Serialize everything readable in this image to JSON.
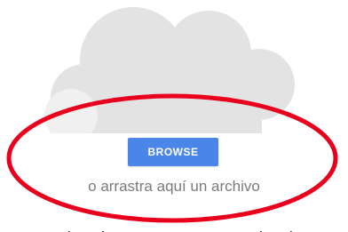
{
  "upload": {
    "button_label": "BROWSE",
    "drop_hint": "o arrastra aquí un archivo"
  },
  "colors": {
    "button": "#4a86e8",
    "cloud": "#e3e3e3",
    "cloud_dark": "#dcdcdc",
    "highlight": "#e8001c",
    "hint_text": "#7a7a7a"
  },
  "icons": [
    "cloud-icon"
  ]
}
